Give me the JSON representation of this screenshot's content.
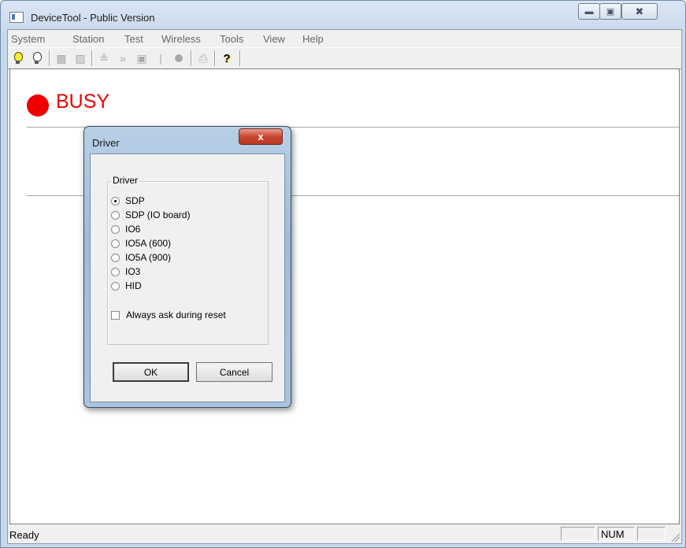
{
  "window": {
    "title": "DeviceTool - Public Version"
  },
  "menu": [
    "System",
    "Station",
    "Test",
    "Wireless",
    "Tools",
    "View",
    "Help"
  ],
  "toolbar": {
    "icons": [
      "bulb-on-icon",
      "bulb-off-icon",
      "connect-icon",
      "disconnect-icon",
      "wireless-icon",
      "forward-icon",
      "device-icon",
      "bar-icon",
      "record-icon",
      "print-icon",
      "help-icon"
    ],
    "help_glyph": "?"
  },
  "view": {
    "busy_label": "BUSY",
    "busy_color": "#ee0000"
  },
  "status": {
    "text": "Ready",
    "num_indicator": "NUM"
  },
  "dialog": {
    "title": "Driver",
    "close_glyph": "x",
    "group_label": "Driver",
    "options": [
      {
        "label": "SDP",
        "checked": true
      },
      {
        "label": "SDP (IO board)",
        "checked": false
      },
      {
        "label": "IO6",
        "checked": false
      },
      {
        "label": "IO5A (600)",
        "checked": false
      },
      {
        "label": "IO5A (900)",
        "checked": false
      },
      {
        "label": "IO3",
        "checked": false
      },
      {
        "label": "HID",
        "checked": false
      }
    ],
    "always_ask_label": "Always ask during reset",
    "always_ask_checked": false,
    "ok_label": "OK",
    "cancel_label": "Cancel"
  }
}
